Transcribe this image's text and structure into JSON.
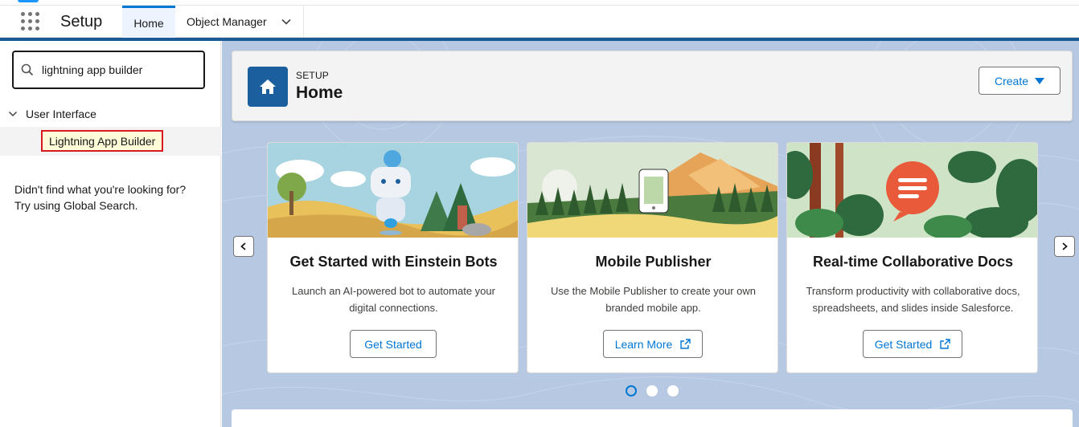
{
  "app": {
    "title": "Setup"
  },
  "tabs": [
    {
      "label": "Home",
      "active": true
    },
    {
      "label": "Object Manager",
      "active": false
    }
  ],
  "sidebar": {
    "search": {
      "value": "lightning app builder",
      "placeholder": "Quick Find"
    },
    "tree": {
      "parent_label": "User Interface",
      "child_label": "Lightning App Builder"
    },
    "not_found_line1": "Didn't find what you're looking for?",
    "not_found_line2": "Try using Global Search."
  },
  "header": {
    "eyebrow": "SETUP",
    "title": "Home",
    "create_label": "Create"
  },
  "cards": [
    {
      "title": "Get Started with Einstein Bots",
      "description": "Launch an AI-powered bot to automate your digital connections.",
      "button_label": "Get Started",
      "external": false
    },
    {
      "title": "Mobile Publisher",
      "description": "Use the Mobile Publisher to create your own branded mobile app.",
      "button_label": "Learn More",
      "external": true
    },
    {
      "title": "Real-time Collaborative Docs",
      "description": "Transform productivity with collaborative docs, spreadsheets, and slides inside Salesforce.",
      "button_label": "Get Started",
      "external": true
    }
  ],
  "carousel": {
    "page_count": 3,
    "active_index": 0
  },
  "colors": {
    "brand_blue": "#0176d3",
    "header_blue": "#1a5a96",
    "highlight_red": "#d71920",
    "highlight_fill": "#fdfbd8",
    "background": "#b0c4df"
  }
}
